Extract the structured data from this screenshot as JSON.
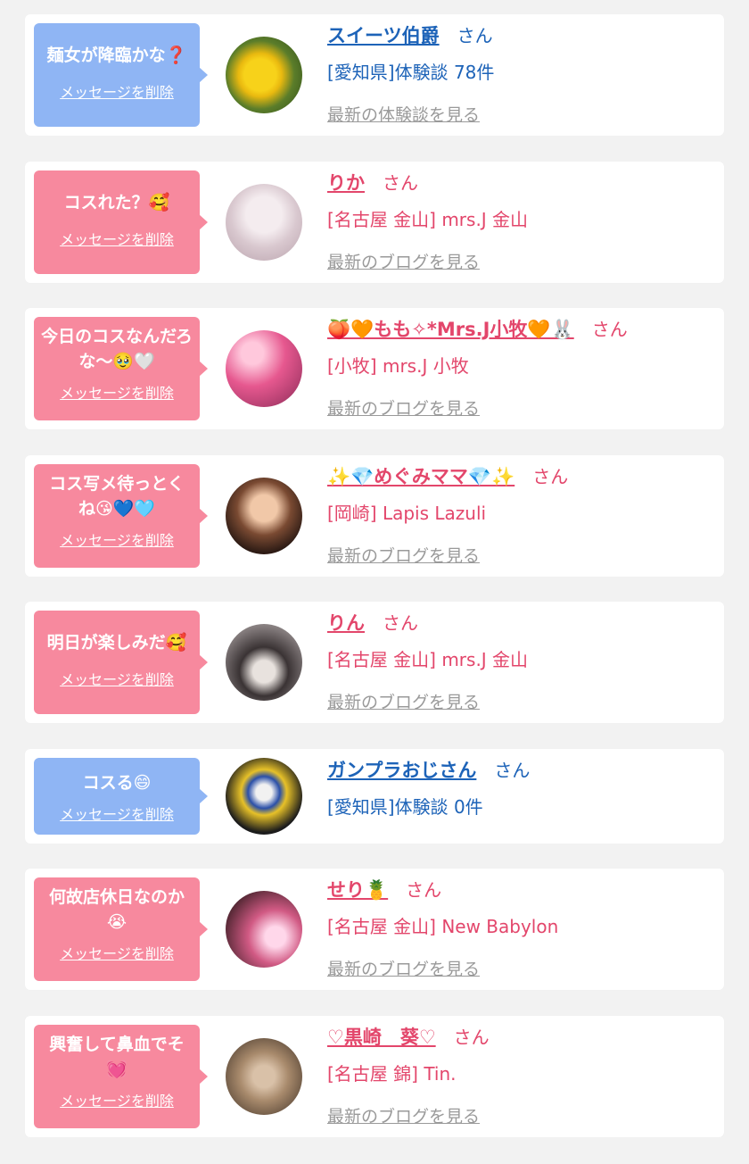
{
  "delete_label": "メッセージを削除",
  "honorific": "さん",
  "colors": {
    "pink": "#f7899e",
    "blue": "#8fb5f4",
    "pink_text": "#e3466b",
    "blue_text": "#1d63b8"
  },
  "cards": [
    {
      "message": "麺女が降臨かな❓",
      "name": "スイーツ伯爵",
      "info": "[愛知県]体験談 78件",
      "link": "最新の体験談を見る",
      "type": "customer",
      "avatar": "yellow-flower-photo"
    },
    {
      "message": "コスれた？🥰",
      "name": "りか",
      "info": "[名古屋 金山] mrs.J 金山",
      "link": "最新のブログを見る",
      "type": "girl",
      "avatar": "blurred-selfie-photo"
    },
    {
      "message": "今日のコスなんだろな〜🥹🤍",
      "name": "🍑🧡もも✧*Mrs.J小牧🧡🐰",
      "info": "[小牧] mrs.J 小牧",
      "link": "最新のブログを見る",
      "type": "girl",
      "avatar": "pink-light-photo"
    },
    {
      "message": "コス写メ待っとくね😘💙🩵",
      "name": "✨💎めぐみママ💎✨",
      "info": "[岡崎] Lapis Lazuli",
      "link": "最新のブログを見る",
      "type": "girl",
      "avatar": "woman-photo"
    },
    {
      "message": "明日が楽しみだ🥰",
      "name": "りん",
      "info": "[名古屋 金山] mrs.J 金山",
      "link": "最新のブログを見る",
      "type": "girl",
      "avatar": "masked-selfie-photo"
    },
    {
      "message": "コスる😄",
      "name": "ガンプラおじさん",
      "info": "[愛知県]体験談 0件",
      "link": "",
      "type": "customer",
      "avatar": "gundam-model-photo"
    },
    {
      "message": "何故店休日なのか😭",
      "name": "せり🍍",
      "info": "[名古屋 金山] New Babylon",
      "link": "最新のブログを見る",
      "type": "girl",
      "avatar": "pink-hair-photo"
    },
    {
      "message": "興奮して鼻血でそ💓",
      "name": "♡黒崎　葵♡",
      "info": "[名古屋 錦] Tin.",
      "link": "最新のブログを見る",
      "type": "girl",
      "avatar": "room-photo"
    }
  ]
}
